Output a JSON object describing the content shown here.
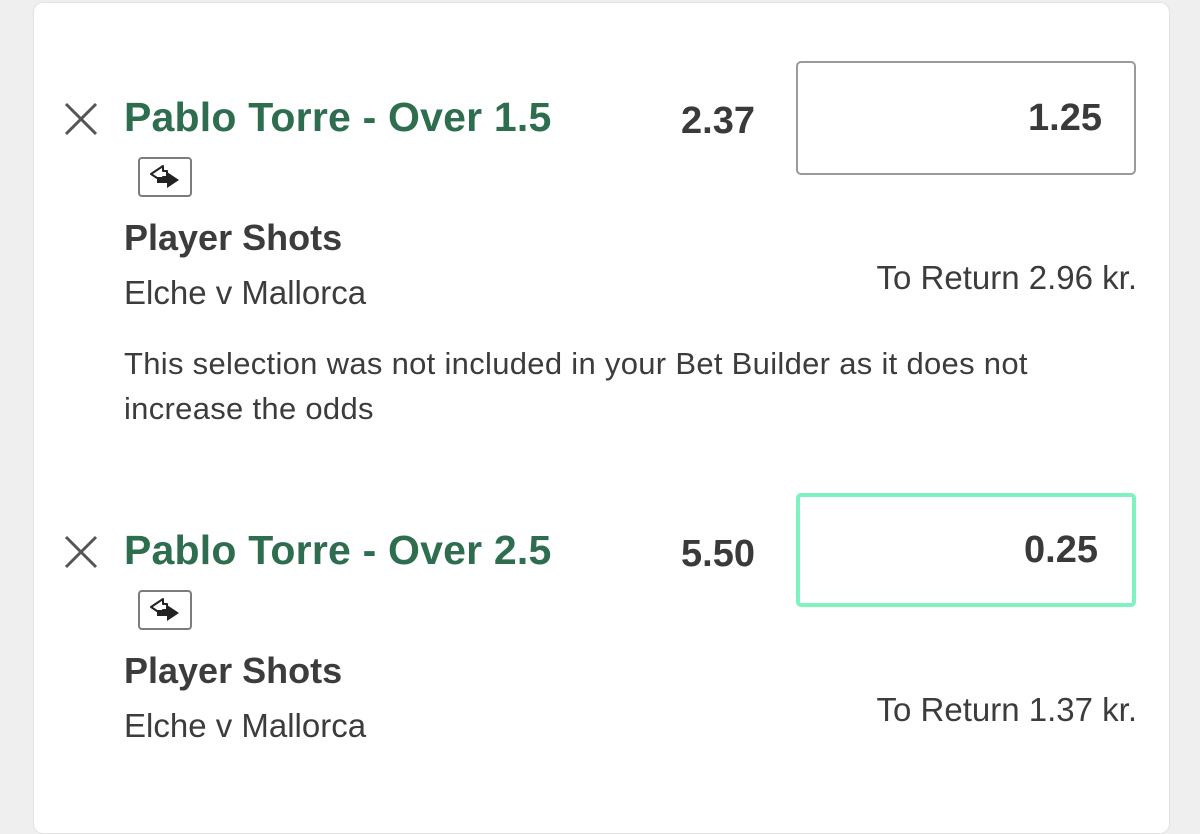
{
  "selections": [
    {
      "title": "Pablo Torre - Over 1.5",
      "odds": "2.37",
      "stake": "1.25",
      "market": "Player Shots",
      "event": "Elche v Mallorca",
      "to_return": "To Return 2.96 kr.",
      "notice": "This selection was not included in your Bet Builder as it does not increase the odds",
      "icon": "bet-builder-icon"
    },
    {
      "title": "Pablo Torre - Over 2.5",
      "odds": "5.50",
      "stake": "0.25",
      "market": "Player Shots",
      "event": "Elche v Mallorca",
      "to_return": "To Return 1.37 kr.",
      "icon": "bet-builder-icon"
    }
  ],
  "colors": {
    "title_green": "#2e6e4f",
    "active_border": "#7ef2bf",
    "text": "#3c3c3c"
  }
}
